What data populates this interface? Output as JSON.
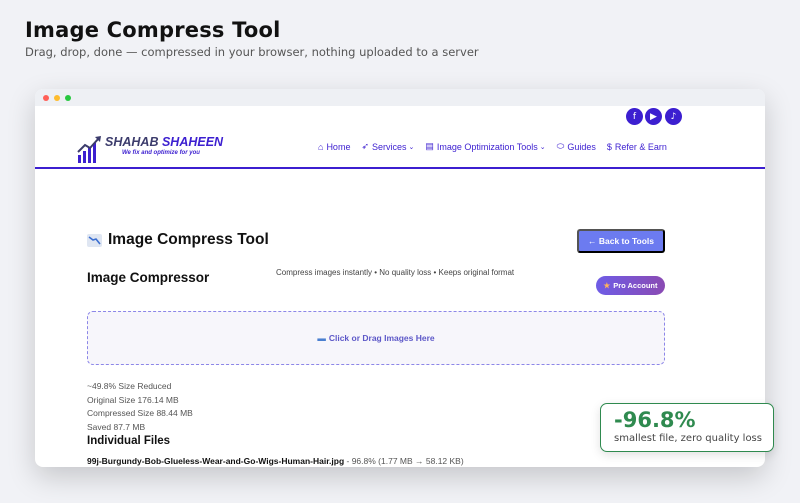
{
  "page": {
    "title": "Image Compress Tool",
    "subtitle": "Drag, drop, done — compressed in your browser, nothing uploaded to a server"
  },
  "social": [
    {
      "icon": "facebook-icon",
      "glyph": "f"
    },
    {
      "icon": "youtube-icon",
      "glyph": "▶"
    },
    {
      "icon": "tiktok-icon",
      "glyph": "♪"
    }
  ],
  "logo": {
    "name_part1": "SHAHAB",
    "name_part2": "SHAHEEN",
    "tagline": "We fix and optimize for you"
  },
  "nav": {
    "home": "Home",
    "services": "Services",
    "image_tools": "Image Optimization Tools",
    "guides": "Guides",
    "refer": "Refer & Earn"
  },
  "tool": {
    "title": "Image Compress Tool",
    "back_button": "← Back to Tools",
    "compressor_title": "Image Compressor",
    "compressor_subtitle": "Compress images instantly • No quality loss • Keeps original format",
    "pro_badge": "Pro Account",
    "dropzone_label": "Click or Drag Images Here"
  },
  "stats": {
    "reduced": "~49.8% Size Reduced",
    "original": "Original Size 176.14 MB",
    "compressed": "Compressed Size 88.44 MB",
    "saved": "Saved 87.7 MB"
  },
  "files": {
    "heading": "Individual Files",
    "items": [
      {
        "name": "99j-Burgundy-Bob-Glueless-Wear-and-Go-Wigs-Human-Hair.jpg",
        "detail": " - 96.8% (1.77 MB → 58.12 KB)"
      }
    ]
  },
  "result_card": {
    "percent": "-96.8%",
    "description": "smallest file, zero quality loss"
  },
  "colors": {
    "brand": "#3c1fd0",
    "button": "#6c7bf0",
    "success": "#2f8a4f"
  }
}
